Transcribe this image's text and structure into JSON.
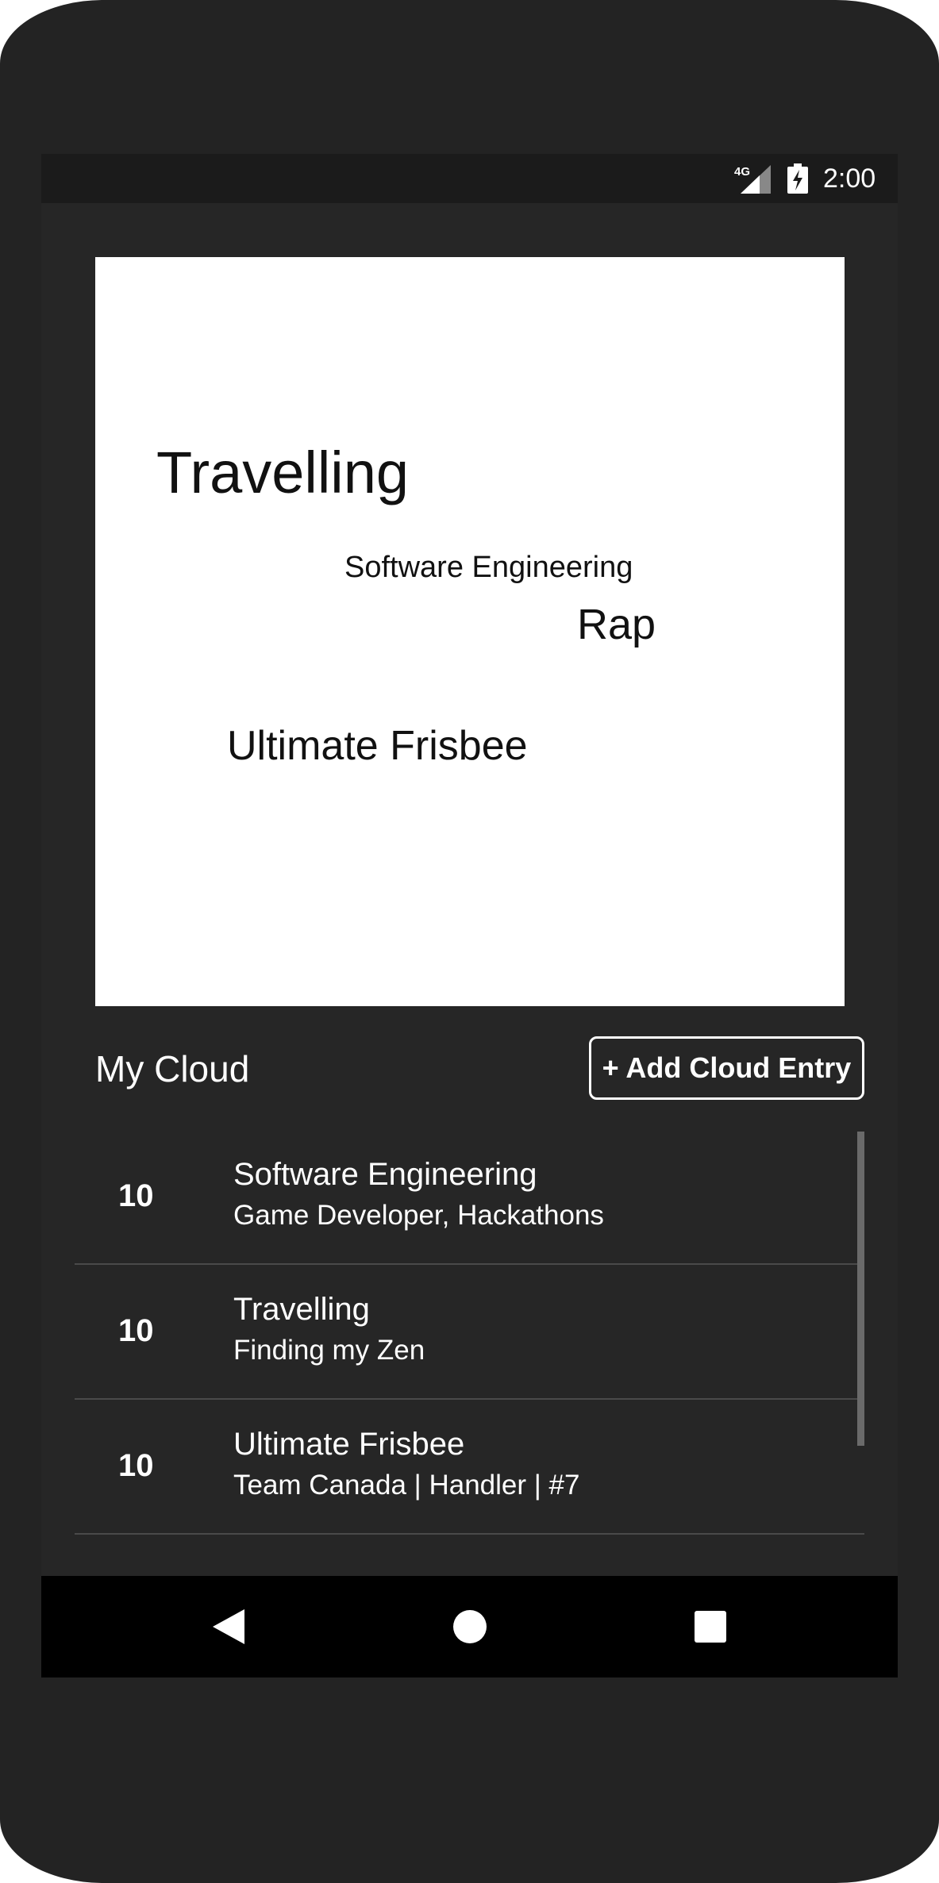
{
  "status_bar": {
    "network": "4G",
    "time": "2:00",
    "icons": [
      "signal-icon",
      "battery-charging-icon"
    ]
  },
  "word_cloud": {
    "words": [
      {
        "text": "Travelling"
      },
      {
        "text": "Software Engineering"
      },
      {
        "text": "Rap"
      },
      {
        "text": "Ultimate Frisbee"
      }
    ]
  },
  "section": {
    "title": "My Cloud",
    "add_button_label": "+ Add Cloud Entry"
  },
  "entries": [
    {
      "score": "10",
      "title": "Software Engineering",
      "subtitle": "Game Developer, Hackathons"
    },
    {
      "score": "10",
      "title": "Travelling",
      "subtitle": "Finding my Zen"
    },
    {
      "score": "10",
      "title": "Ultimate Frisbee",
      "subtitle": "Team Canada | Handler | #7"
    }
  ],
  "nav_bar": {
    "icons": [
      "back-icon",
      "home-icon",
      "recent-apps-icon"
    ]
  },
  "colors": {
    "device": "#232323",
    "screen_background": "#262626",
    "status_bar": "#1b1b1b",
    "nav_bar": "#000000",
    "text": "#ffffff",
    "cloud_background": "#ffffff"
  }
}
